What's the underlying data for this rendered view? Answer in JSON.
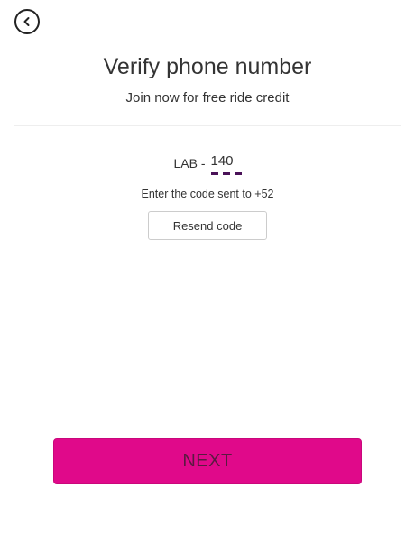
{
  "header": {
    "back_icon": "chevron-left-icon",
    "title": "Verify phone number",
    "subtitle": "Join now for free ride credit"
  },
  "verification": {
    "code_prefix": "LAB -",
    "code_value": "140",
    "hint": "Enter the code sent to +52",
    "resend_label": "Resend code"
  },
  "actions": {
    "next_label": "NEXT"
  },
  "colors": {
    "accent": "#e0098a",
    "code_underline": "#4a1258"
  }
}
